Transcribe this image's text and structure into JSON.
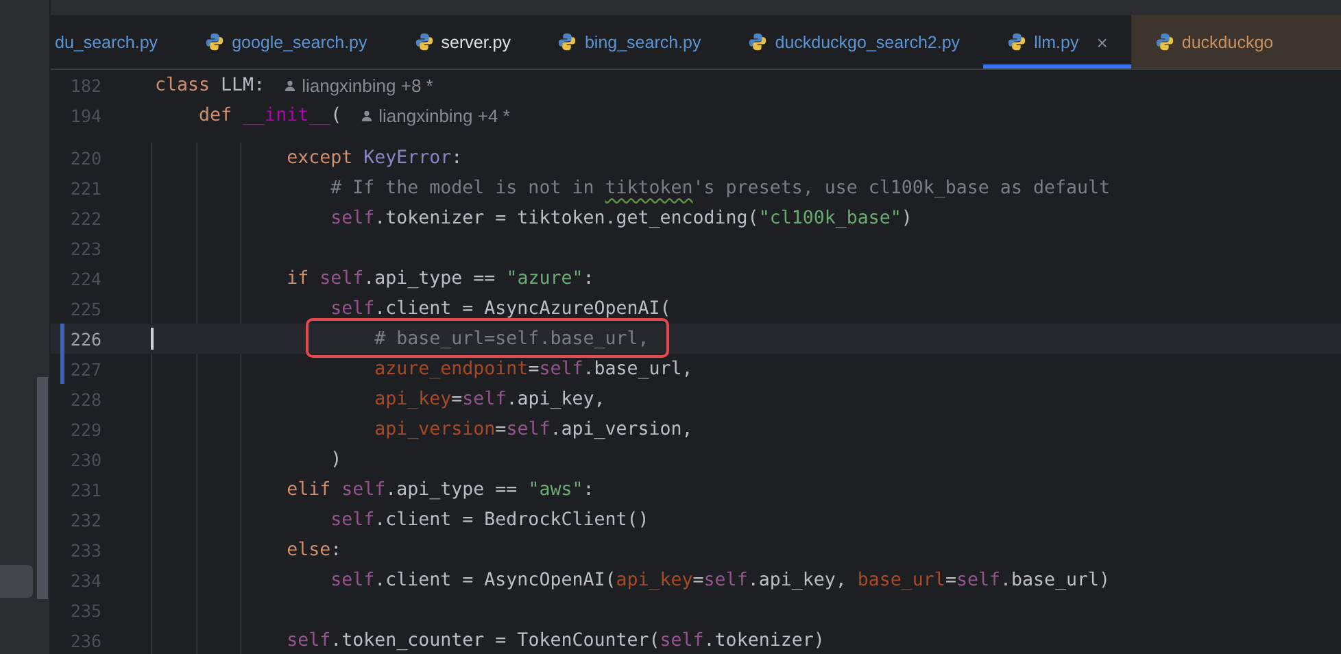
{
  "tabs": [
    {
      "label": "du_search.py",
      "icon": false,
      "color": "#5a96d6",
      "selected": false
    },
    {
      "label": "google_search.py",
      "icon": true,
      "color": "#5a96d6",
      "selected": false
    },
    {
      "label": "server.py",
      "icon": true,
      "color": "#dfe1e5",
      "selected": false
    },
    {
      "label": "bing_search.py",
      "icon": true,
      "color": "#5a96d6",
      "selected": false
    },
    {
      "label": "duckduckgo_search2.py",
      "icon": true,
      "color": "#5a96d6",
      "selected": false
    },
    {
      "label": "llm.py",
      "icon": true,
      "color": "#5a96d6",
      "selected": true,
      "close": "×"
    },
    {
      "label": "duckduckgo",
      "icon": true,
      "color": "#c8915e",
      "selected": false
    }
  ],
  "sticky_lines": [
    {
      "number": "182",
      "author": "liangxinbing +8 *",
      "tokens": [
        {
          "kind": "keyword",
          "text": "class "
        },
        {
          "kind": "plain",
          "text": "LLM:"
        }
      ]
    },
    {
      "number": "194",
      "author": "liangxinbing +4 *",
      "tokens": [
        {
          "kind": "keyword",
          "text": "    def "
        },
        {
          "kind": "magic",
          "text": "__init__"
        },
        {
          "kind": "plain",
          "text": "("
        }
      ]
    }
  ],
  "lines": [
    {
      "number": "220",
      "current": false,
      "changed": false,
      "annotated": false,
      "tokens": [
        {
          "kind": "keyword",
          "text": "            except "
        },
        {
          "kind": "class",
          "text": "KeyError"
        },
        {
          "kind": "plain",
          "text": ":"
        }
      ]
    },
    {
      "number": "221",
      "current": false,
      "changed": false,
      "annotated": false,
      "tokens": [
        {
          "kind": "comment",
          "text": "                # If the model is not in "
        },
        {
          "kind": "typo",
          "text": "tiktoken"
        },
        {
          "kind": "comment",
          "text": "'s presets, use cl100k_base as default"
        }
      ]
    },
    {
      "number": "222",
      "current": false,
      "changed": false,
      "annotated": false,
      "tokens": [
        {
          "kind": "self",
          "text": "                self"
        },
        {
          "kind": "plain",
          "text": ".tokenizer = tiktoken.get_encoding("
        },
        {
          "kind": "string",
          "text": "\"cl100k_base\""
        },
        {
          "kind": "plain",
          "text": ")"
        }
      ]
    },
    {
      "number": "223",
      "current": false,
      "changed": false,
      "annotated": false
    },
    {
      "number": "224",
      "current": false,
      "changed": false,
      "annotated": false,
      "tokens": [
        {
          "kind": "keyword",
          "text": "            if "
        },
        {
          "kind": "self",
          "text": "self"
        },
        {
          "kind": "plain",
          "text": ".api_type == "
        },
        {
          "kind": "string",
          "text": "\"azure\""
        },
        {
          "kind": "plain",
          "text": ":"
        }
      ]
    },
    {
      "number": "225",
      "current": false,
      "changed": false,
      "annotated": false,
      "tokens": [
        {
          "kind": "self",
          "text": "                self"
        },
        {
          "kind": "plain",
          "text": ".client = AsyncAzureOpenAI("
        }
      ]
    },
    {
      "number": "226",
      "current": true,
      "changed": true,
      "annotated": true,
      "tokens": [
        {
          "kind": "comment",
          "text": "                    # base_url=self.base_url,"
        }
      ]
    },
    {
      "number": "227",
      "current": false,
      "changed": true,
      "annotated": false,
      "tokens": [
        {
          "kind": "param",
          "text": "                    azure_endpoint"
        },
        {
          "kind": "plain",
          "text": "="
        },
        {
          "kind": "self",
          "text": "self"
        },
        {
          "kind": "plain",
          "text": ".base_url,"
        }
      ]
    },
    {
      "number": "228",
      "current": false,
      "changed": false,
      "annotated": false,
      "tokens": [
        {
          "kind": "param",
          "text": "                    api_key"
        },
        {
          "kind": "plain",
          "text": "="
        },
        {
          "kind": "self",
          "text": "self"
        },
        {
          "kind": "plain",
          "text": ".api_key,"
        }
      ]
    },
    {
      "number": "229",
      "current": false,
      "changed": false,
      "annotated": false,
      "tokens": [
        {
          "kind": "param",
          "text": "                    api_version"
        },
        {
          "kind": "plain",
          "text": "="
        },
        {
          "kind": "self",
          "text": "self"
        },
        {
          "kind": "plain",
          "text": ".api_version,"
        }
      ]
    },
    {
      "number": "230",
      "current": false,
      "changed": false,
      "annotated": false,
      "tokens": [
        {
          "kind": "plain",
          "text": "                )"
        }
      ]
    },
    {
      "number": "231",
      "current": false,
      "changed": false,
      "annotated": false,
      "tokens": [
        {
          "kind": "keyword",
          "text": "            elif "
        },
        {
          "kind": "self",
          "text": "self"
        },
        {
          "kind": "plain",
          "text": ".api_type == "
        },
        {
          "kind": "string",
          "text": "\"aws\""
        },
        {
          "kind": "plain",
          "text": ":"
        }
      ]
    },
    {
      "number": "232",
      "current": false,
      "changed": false,
      "annotated": false,
      "tokens": [
        {
          "kind": "self",
          "text": "                self"
        },
        {
          "kind": "plain",
          "text": ".client = BedrockClient()"
        }
      ]
    },
    {
      "number": "233",
      "current": false,
      "changed": false,
      "annotated": false,
      "tokens": [
        {
          "kind": "keyword",
          "text": "            else"
        },
        {
          "kind": "plain",
          "text": ":"
        }
      ]
    },
    {
      "number": "234",
      "current": false,
      "changed": false,
      "annotated": false,
      "tokens": [
        {
          "kind": "self",
          "text": "                self"
        },
        {
          "kind": "plain",
          "text": ".client = AsyncOpenAI("
        },
        {
          "kind": "param",
          "text": "api_key"
        },
        {
          "kind": "plain",
          "text": "="
        },
        {
          "kind": "self",
          "text": "self"
        },
        {
          "kind": "plain",
          "text": ".api_key, "
        },
        {
          "kind": "param",
          "text": "base_url"
        },
        {
          "kind": "plain",
          "text": "="
        },
        {
          "kind": "self",
          "text": "self"
        },
        {
          "kind": "plain",
          "text": ".base_url)"
        }
      ]
    },
    {
      "number": "235",
      "current": false,
      "changed": false,
      "annotated": false
    },
    {
      "number": "236",
      "current": false,
      "changed": false,
      "annotated": false,
      "tokens": [
        {
          "kind": "self",
          "text": "            self"
        },
        {
          "kind": "plain",
          "text": ".token_counter = TokenCounter("
        },
        {
          "kind": "self",
          "text": "self"
        },
        {
          "kind": "plain",
          "text": ".tokenizer)"
        }
      ]
    }
  ]
}
